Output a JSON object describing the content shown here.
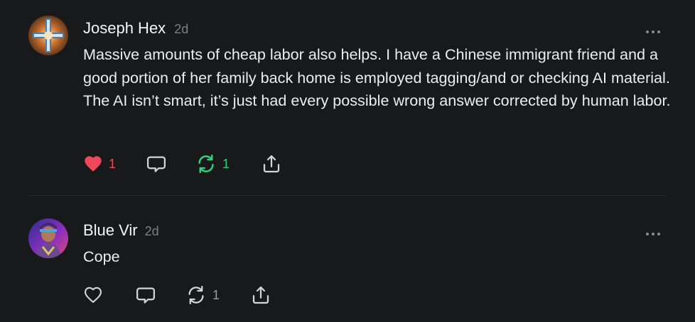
{
  "posts": [
    {
      "author": "Joseph Hex",
      "time": "2d",
      "text": "Massive amounts of cheap labor also helps. I have a Chinese immigrant friend and a good portion of her family back home is employed tagging/and or checking AI material. The AI isn’t smart, it’s just had every possible wrong answer corrected by human labor.",
      "likes": "1",
      "reposts": "1",
      "liked": true,
      "reposted": true
    },
    {
      "author": "Blue Vir",
      "time": "2d",
      "text": "Cope",
      "reposts": "1",
      "liked": false,
      "reposted": false
    }
  ],
  "icons": {
    "like": "heart-icon",
    "reply": "comment-icon",
    "repost": "repost-icon",
    "share": "share-icon",
    "more": "more-icon"
  },
  "colors": {
    "background": "#18191b",
    "like_active": "#f0485b",
    "repost_active": "#2fd07a",
    "icon_inactive": "#d4d5d8",
    "muted": "#7d7f84"
  }
}
